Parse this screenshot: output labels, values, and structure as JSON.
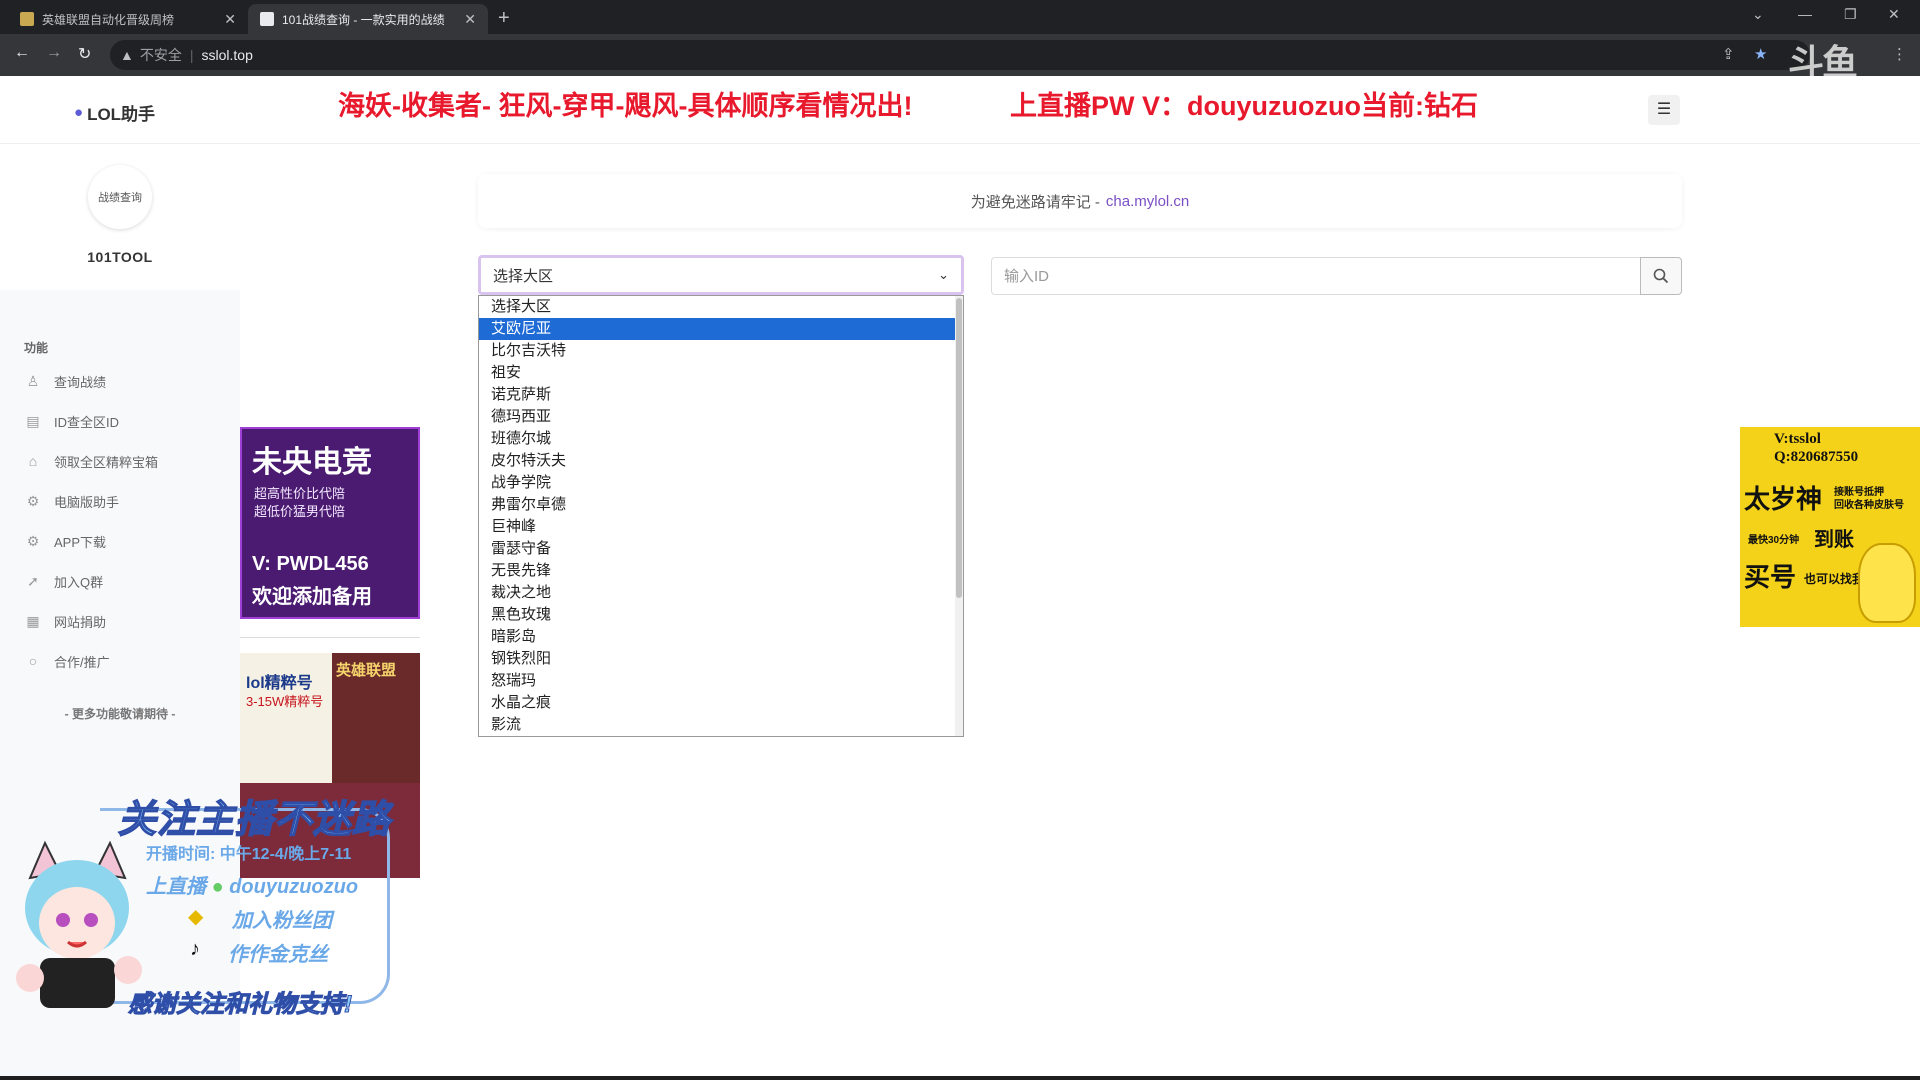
{
  "browser": {
    "tabs": [
      {
        "label": "英雄联盟自动化晋级周榜",
        "active": false
      },
      {
        "label": "101战绩查询 - 一款实用的战绩",
        "active": true
      }
    ],
    "address": {
      "security": "不安全",
      "url": "sslol.top"
    },
    "overlay_logo": "斗鱼"
  },
  "header": {
    "brand": "LOL助手",
    "banner_left": "海妖-收集者- 狂风-穿甲-飓风-具体顺序看情况出!",
    "banner_right": "上直播PW V：douyuzuozuo当前:钻石"
  },
  "sidebar": {
    "profile_name": "101TOOL",
    "avatar_text": "战绩查询",
    "section_title": "功能",
    "items": [
      {
        "label": "查询战绩",
        "icon": "user-icon"
      },
      {
        "label": "ID查全区ID",
        "icon": "book-icon"
      },
      {
        "label": "领取全区精粹宝箱",
        "icon": "graduation-icon"
      },
      {
        "label": "电脑版助手",
        "icon": "cog-icon"
      },
      {
        "label": "APP下载",
        "icon": "cog-icon"
      },
      {
        "label": "加入Q群",
        "icon": "rocket-icon"
      },
      {
        "label": "网站捐助",
        "icon": "grid-icon"
      },
      {
        "label": "合作/推广",
        "icon": "bulb-icon"
      }
    ],
    "more": "- 更多功能敬请期待 -"
  },
  "main": {
    "notice_text": "为避免迷路请牢记 -",
    "notice_link": "cha.mylol.cn",
    "region_select": {
      "value": "选择大区",
      "highlighted": "艾欧尼亚",
      "options": [
        "选择大区",
        "艾欧尼亚",
        "比尔吉沃特",
        "祖安",
        "诺克萨斯",
        "德玛西亚",
        "班德尔城",
        "皮尔特沃夫",
        "战争学院",
        "弗雷尔卓德",
        "巨神峰",
        "雷瑟守备",
        "无畏先锋",
        "裁决之地",
        "黑色玫瑰",
        "暗影岛",
        "钢铁烈阳",
        "怒瑞玛",
        "水晶之痕",
        "影流"
      ]
    },
    "id_input": {
      "placeholder": "输入ID",
      "value": ""
    }
  },
  "ads": {
    "left_top": {
      "title": "未央电竞",
      "line1": "超高性价比代陪",
      "line2": "超低价猛男代陪",
      "contact": "V: PWDL456",
      "slogan": "欢迎添加备用"
    },
    "left_mid": {
      "left_title": "lol精粹号",
      "left_sub": "3-15W精粹号",
      "right_title": "英雄联盟"
    },
    "right": {
      "v": "V:tsslol",
      "q": "Q:820687550",
      "brand": "太岁神",
      "sub1": "接账号抵押",
      "sub2": "回收各种皮肤号",
      "fast": "最快30分钟",
      "arrive": "到账",
      "buy": "买号",
      "buy_sub": "也可以找我"
    }
  },
  "overlay": {
    "follow": "关注主播不迷路",
    "time": "开播时间: 中午12-4/晚上7-11",
    "live": "上直播",
    "live_id": "douyuzuozuo",
    "fans": "加入粉丝团",
    "tiktok": "作作金克丝",
    "thanks": "感谢关注和礼物支持!"
  }
}
